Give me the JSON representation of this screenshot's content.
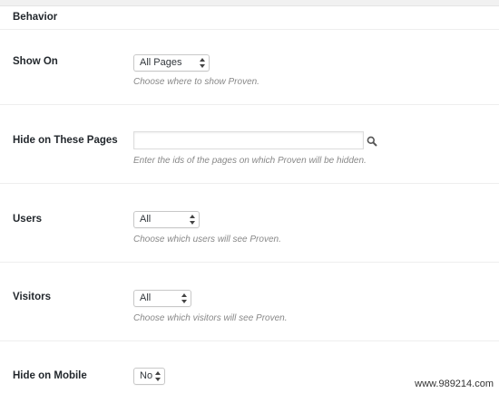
{
  "section": {
    "title": "Behavior"
  },
  "fields": {
    "show_on": {
      "label": "Show On",
      "value": "All Pages",
      "hint": "Choose where to show Proven."
    },
    "hide_pages": {
      "label": "Hide on These Pages",
      "value": "",
      "hint": "Enter the ids of the pages on which Proven will be hidden."
    },
    "users": {
      "label": "Users",
      "value": "All",
      "hint": "Choose which users will see Proven."
    },
    "visitors": {
      "label": "Visitors",
      "value": "All",
      "hint": "Choose which visitors will see Proven."
    },
    "hide_mobile": {
      "label": "Hide on Mobile",
      "value": "No"
    }
  },
  "icons": {
    "search": "search-icon",
    "select_arrows": "chevron-up-down-icon"
  },
  "watermark": "www.989214.com"
}
